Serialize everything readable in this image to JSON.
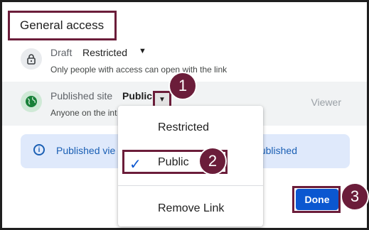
{
  "section_title": "General access",
  "draft": {
    "label": "Draft",
    "value": "Restricted",
    "subtext": "Only people with access can open with the link"
  },
  "published": {
    "label": "Published site",
    "value": "Public",
    "subtext": "Anyone on the int",
    "role": "Viewer"
  },
  "info_bar": {
    "text_left": "Published vie",
    "text_right": "ublished"
  },
  "menu": {
    "items": [
      "Restricted",
      "Public",
      "Remove Link"
    ],
    "selected": "Public"
  },
  "done_label": "Done",
  "callouts": [
    "1",
    "2",
    "3"
  ],
  "colors": {
    "annotation": "#6b1d3a",
    "accent": "#0b57d0",
    "info_bg": "#dfe9fb"
  }
}
